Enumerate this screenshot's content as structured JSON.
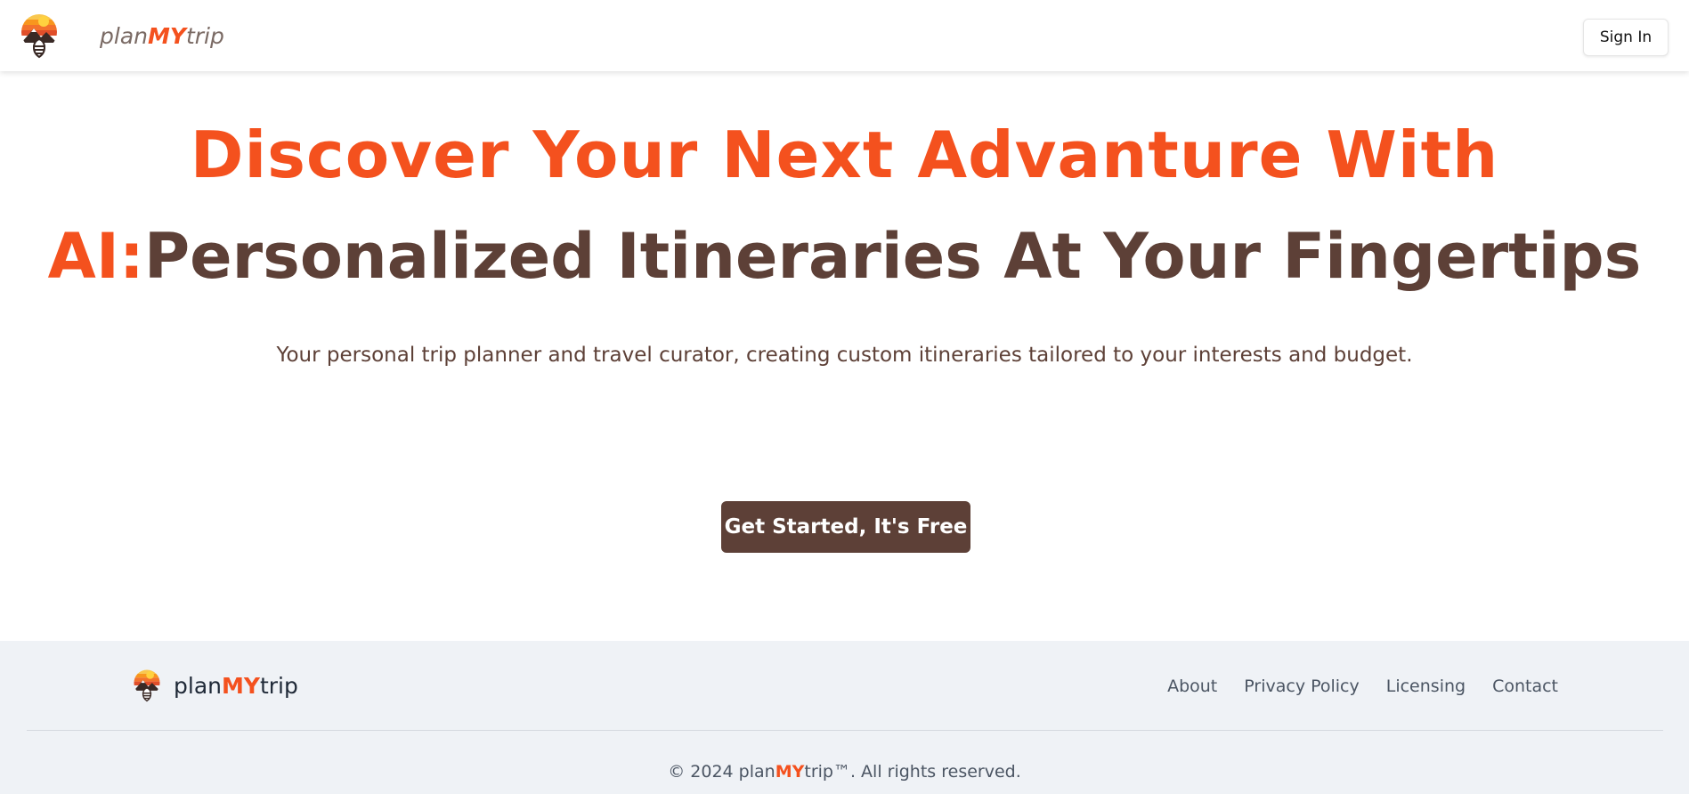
{
  "header": {
    "brand": {
      "prefix": "plan",
      "highlight": "MY",
      "suffix": "trip"
    },
    "sign_in_label": "Sign In"
  },
  "hero": {
    "line1": "Discover Your Next Advanture With",
    "line2_accent": "AI:",
    "line2_rest": "Personalized Itineraries At Your Fingertips",
    "subtitle": "Your personal trip planner and travel curator, creating custom itineraries tailored to your interests and budget.",
    "cta_label": "Get Started, It's Free"
  },
  "footer": {
    "brand": {
      "prefix": "plan",
      "highlight": "MY",
      "suffix": "trip"
    },
    "nav": [
      "About",
      "Privacy Policy",
      "Licensing",
      "Contact"
    ],
    "copyright": {
      "prefix": "© 2024 plan",
      "highlight": "MY",
      "suffix": "trip™. All rights reserved."
    }
  },
  "colors": {
    "accent": "#f4511e",
    "brown": "#5d4037",
    "footer_bg": "#eff2f6"
  },
  "icons": {
    "logo": "sunset-mountain-logo-icon"
  }
}
